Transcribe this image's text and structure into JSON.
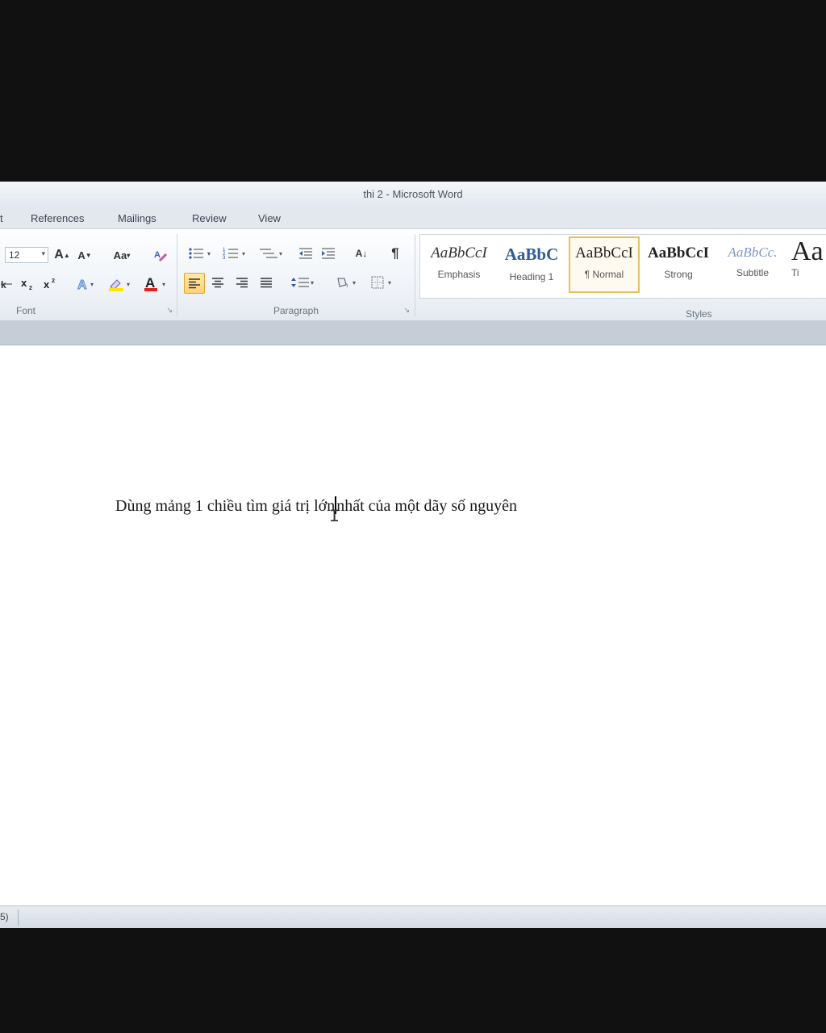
{
  "window": {
    "title": "thi 2  -  Microsoft Word"
  },
  "tabs": [
    {
      "label": "References"
    },
    {
      "label": "Mailings"
    },
    {
      "label": "Review"
    },
    {
      "label": "View"
    }
  ],
  "font_group": {
    "label": "Font",
    "size_value": "12",
    "grow_label": "A",
    "shrink_label": "A",
    "case_label": "Aa",
    "color_label": "A"
  },
  "paragraph_group": {
    "label": "Paragraph",
    "pilcrow": "¶",
    "sort_label": "A↓"
  },
  "styles_group": {
    "label": "Styles",
    "items": [
      {
        "sample": "AaBbCcI",
        "name": "Emphasis"
      },
      {
        "sample": "AaBbC",
        "name": "Heading 1"
      },
      {
        "sample": "AaBbCcI",
        "name": "¶ Normal"
      },
      {
        "sample": "AaBbCcI",
        "name": "Strong"
      },
      {
        "sample": "AaBbCc.",
        "name": "Subtitle"
      },
      {
        "sample": "Aa",
        "name": "Ti"
      }
    ]
  },
  "document": {
    "text_before_caret": "Dùng mảng 1 chiều tìm giá trị lớn",
    "text_after_caret": "nhất của một dãy số nguyên"
  },
  "status": {
    "fragment": "5)"
  }
}
